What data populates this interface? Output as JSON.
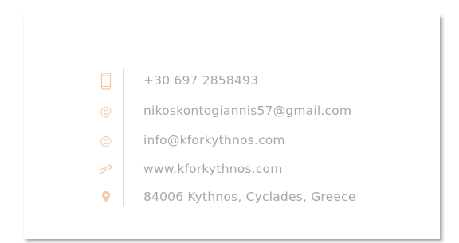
{
  "colors": {
    "accent": "#f2c8ab",
    "text": "#a7a7a7",
    "divider": "#f1d5c2",
    "background": "#ffffff"
  },
  "contacts": [
    {
      "icon": "phone-icon",
      "text": "+30 697 2858493"
    },
    {
      "icon": "at-icon",
      "text": "nikoskontogiannis57@gmail.com"
    },
    {
      "icon": "at-icon",
      "text": "info@kforkythnos.com"
    },
    {
      "icon": "link-icon",
      "text": "www.kforkythnos.com"
    },
    {
      "icon": "location-pin-icon",
      "text": "84006 Kythnos, Cyclades, Greece"
    }
  ]
}
